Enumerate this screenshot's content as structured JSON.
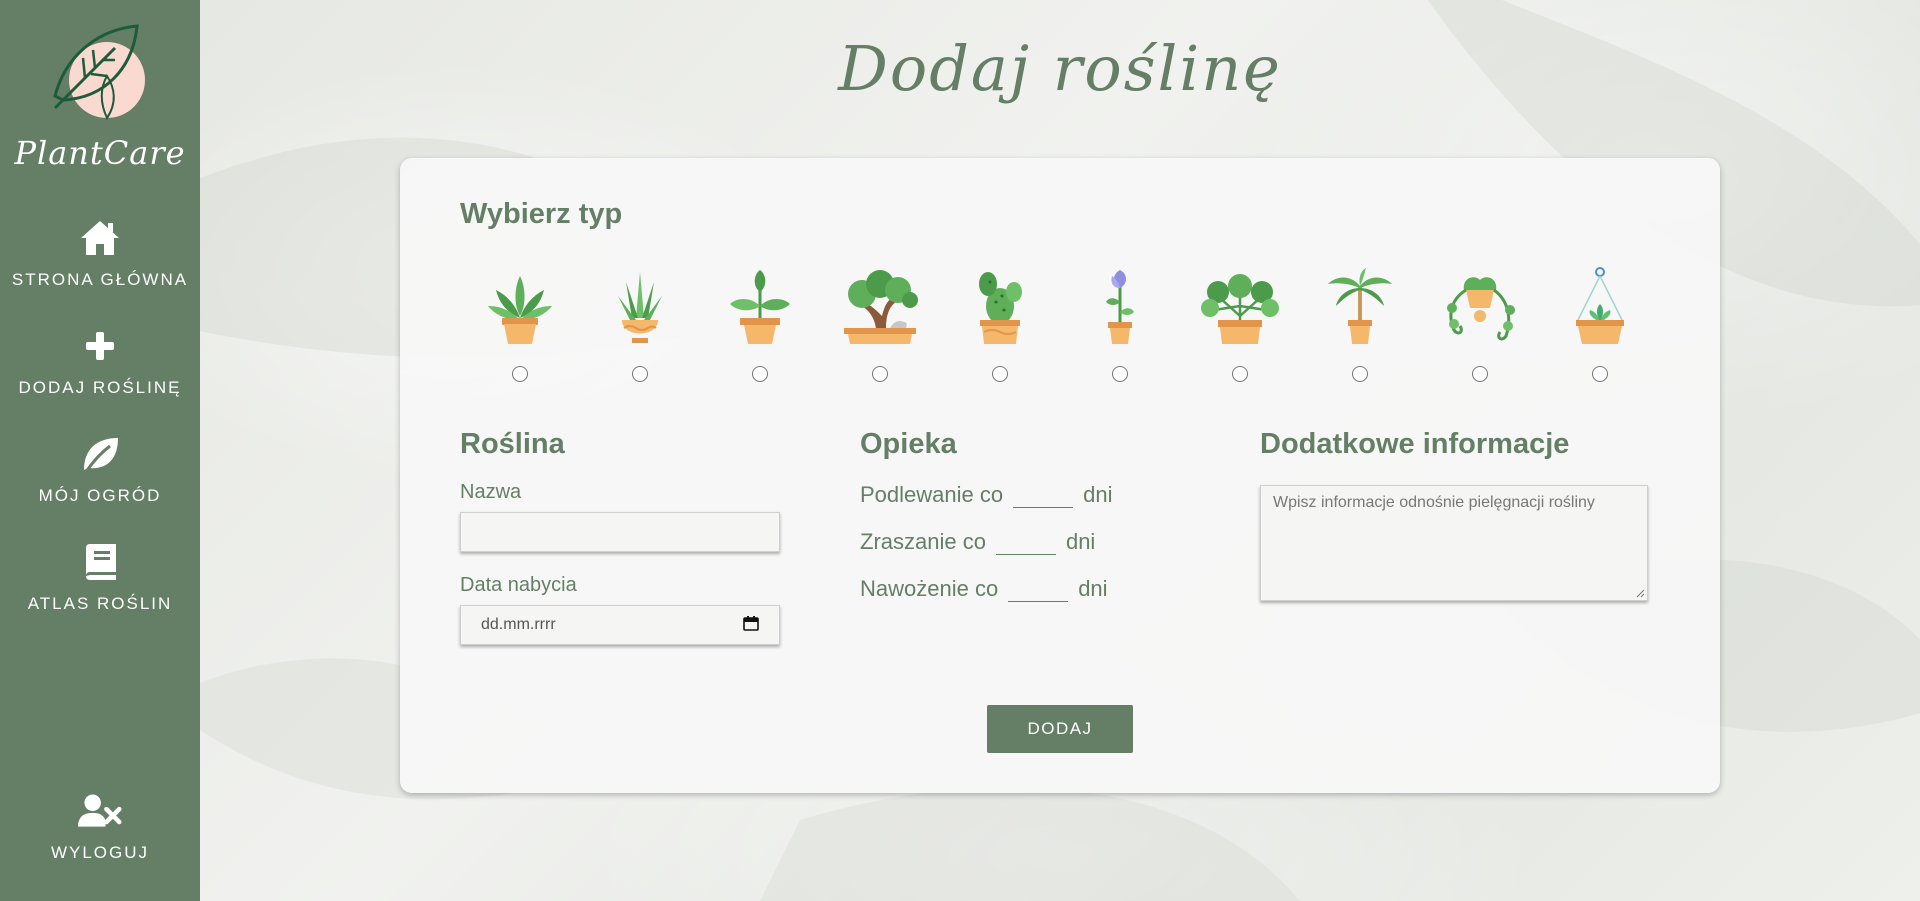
{
  "app": {
    "name": "PlantCare"
  },
  "sidebar": {
    "items": [
      {
        "label": "STRONA GŁÓWNA",
        "icon": "home-icon"
      },
      {
        "label": "DODAJ ROŚLINĘ",
        "icon": "plus-icon"
      },
      {
        "label": "MÓJ OGRÓD",
        "icon": "leaf-icon"
      },
      {
        "label": "ATLAS ROŚLIN",
        "icon": "book-icon"
      }
    ],
    "logout": {
      "label": "WYLOGUJ",
      "icon": "user-remove-icon"
    }
  },
  "page": {
    "title": "Dodaj roślinę"
  },
  "type_picker": {
    "title": "Wybierz typ",
    "options": [
      "succulent",
      "aloe",
      "sprout",
      "bonsai",
      "cactus",
      "flower",
      "pilea",
      "palm",
      "hanging-vine",
      "terrarium"
    ]
  },
  "plant_section": {
    "title": "Roślina",
    "name_label": "Nazwa",
    "name_value": "",
    "date_label": "Data nabycia",
    "date_placeholder": "dd.mm.rrrr"
  },
  "care_section": {
    "title": "Opieka",
    "rows": [
      {
        "prefix": "Podlewanie co",
        "suffix": "dni"
      },
      {
        "prefix": "Zraszanie co",
        "suffix": "dni"
      },
      {
        "prefix": "Nawożenie co",
        "suffix": "dni"
      }
    ]
  },
  "info_section": {
    "title": "Dodatkowe informacje",
    "placeholder": "Wpisz informacje odnośnie pielęgnacji rośliny"
  },
  "submit": {
    "label": "DODAJ"
  },
  "colors": {
    "accent": "#647f66",
    "pot": "#f5b76a",
    "logo_circle": "#f9d9d0"
  }
}
